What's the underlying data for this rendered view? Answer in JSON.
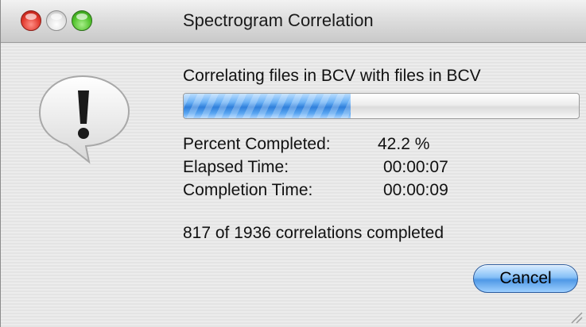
{
  "window": {
    "title": "Spectrogram Correlation"
  },
  "dialog": {
    "icon": "alert-exclamation-icon",
    "message": "Correlating files in BCV with files in BCV",
    "progress_fraction": 0.422,
    "percent_label": "Percent Completed:",
    "percent_value": "42.2 %",
    "elapsed_label": "Elapsed Time:",
    "elapsed_value": "00:00:07",
    "completion_label": "Completion Time:",
    "completion_value": "00:00:09",
    "count_text": "817 of 1936 correlations completed",
    "cancel_label": "Cancel"
  },
  "colors": {
    "accent": "#4f98e6",
    "progress_fill": "#2f7fdb",
    "close": "#e0382c",
    "zoom": "#4fc12a"
  }
}
